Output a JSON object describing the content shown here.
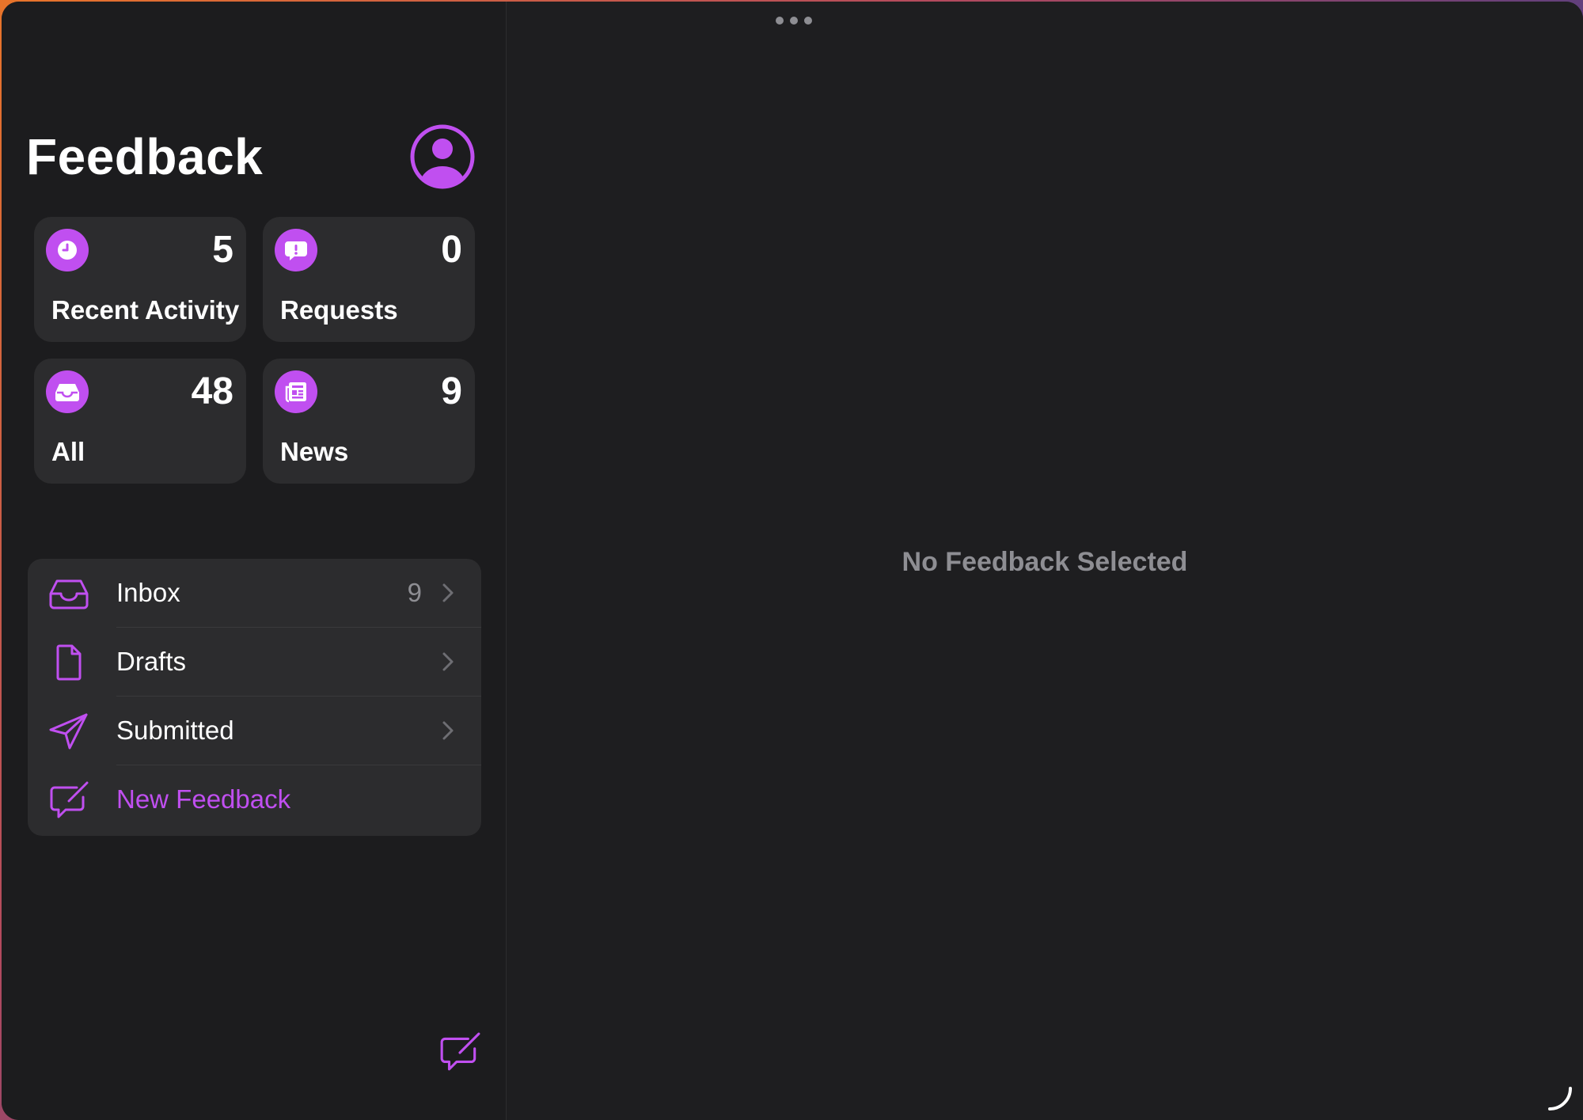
{
  "colors": {
    "accent": "#c04ff0",
    "window_background": "#1d1d1f",
    "card_background": "#2c2c2e",
    "secondary_text": "#8e8e93"
  },
  "toolbar": {
    "more_icon": "ellipsis-icon"
  },
  "sidebar": {
    "title": "Feedback",
    "account_icon": "person-circle-icon",
    "tiles": [
      {
        "label": "Recent Activity",
        "count": "5",
        "icon": "clock-icon"
      },
      {
        "label": "Requests",
        "count": "0",
        "icon": "exclamation-bubble-icon"
      },
      {
        "label": "All",
        "count": "48",
        "icon": "tray-icon"
      },
      {
        "label": "News",
        "count": "9",
        "icon": "newspaper-icon"
      }
    ],
    "list": [
      {
        "label": "Inbox",
        "count": "9",
        "icon": "tray-icon"
      },
      {
        "label": "Drafts",
        "count": "",
        "icon": "document-icon"
      },
      {
        "label": "Submitted",
        "count": "",
        "icon": "paperplane-icon"
      },
      {
        "label": "New Feedback",
        "count": "",
        "icon": "compose-bubble-icon"
      }
    ],
    "compose_icon": "compose-bubble-icon"
  },
  "detail": {
    "empty_message": "No Feedback Selected"
  }
}
